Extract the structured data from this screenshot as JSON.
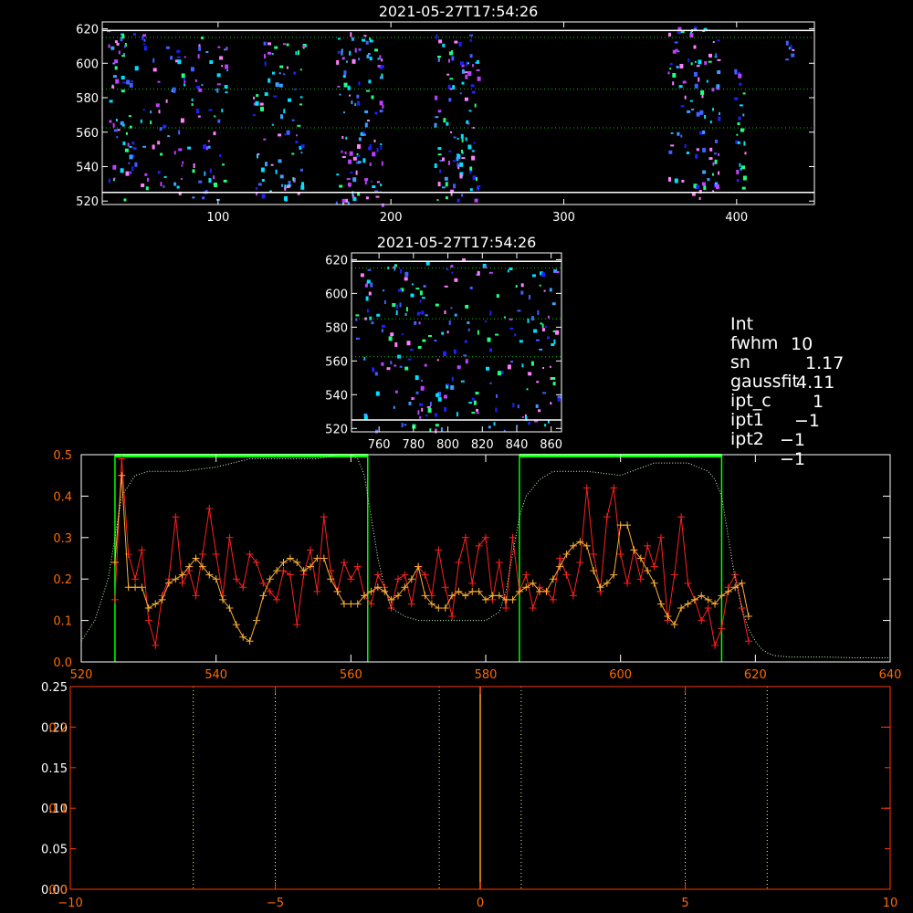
{
  "chart_data": [
    {
      "id": "top-image",
      "type": "heatmap",
      "title": "2021-05-27T17:54:26",
      "xlim": [
        33,
        445
      ],
      "ylim": [
        518,
        624
      ],
      "x_ticks": [
        100,
        200,
        300,
        400
      ],
      "y_ticks": [
        520,
        540,
        560,
        580,
        600,
        620
      ],
      "hlines_white": [
        525,
        619
      ],
      "hlines_green_dotted": [
        562.5,
        585,
        615
      ],
      "colors": {
        "background": "#000000",
        "axis": "#ffffff",
        "guide": "#00c800"
      },
      "pixel_palette": [
        "#2020ff",
        "#4060ff",
        "#3aa0ff",
        "#00e0ff",
        "#20ff80",
        "#c040ff",
        "#ff80ff"
      ],
      "pixel_clusters": [
        {
          "x_range": [
            35,
            52
          ],
          "y_range": [
            520,
            620
          ],
          "count": 60
        },
        {
          "x_range": [
            55,
            105
          ],
          "y_range": [
            520,
            620
          ],
          "count": 110
        },
        {
          "x_range": [
            120,
            150
          ],
          "y_range": [
            522,
            615
          ],
          "count": 80
        },
        {
          "x_range": [
            168,
            195
          ],
          "y_range": [
            518,
            620
          ],
          "count": 110
        },
        {
          "x_range": [
            225,
            250
          ],
          "y_range": [
            520,
            618
          ],
          "count": 100
        },
        {
          "x_range": [
            360,
            390
          ],
          "y_range": [
            522,
            622
          ],
          "count": 100
        },
        {
          "x_range": [
            398,
            405
          ],
          "y_range": [
            528,
            598
          ],
          "count": 25
        },
        {
          "x_range": [
            428,
            432
          ],
          "y_range": [
            598,
            620
          ],
          "count": 6
        }
      ]
    },
    {
      "id": "middle-image",
      "type": "heatmap",
      "title": "2021-05-27T17:54:26",
      "xlim": [
        744,
        866
      ],
      "ylim": [
        518,
        624
      ],
      "x_ticks": [
        760,
        780,
        800,
        820,
        840,
        860
      ],
      "y_ticks": [
        520,
        540,
        560,
        580,
        600,
        620
      ],
      "hlines_white": [
        525,
        619
      ],
      "hlines_green_dotted": [
        562.5,
        585,
        615
      ],
      "colors": {
        "background": "#000000",
        "axis": "#ffffff",
        "guide": "#00c800"
      },
      "pixel_palette": [
        "#2020ff",
        "#4060ff",
        "#3aa0ff",
        "#00e0ff",
        "#20ff80",
        "#c040ff",
        "#ff80ff"
      ],
      "pixel_clusters": [
        {
          "x_range": [
            746,
            864
          ],
          "y_range": [
            519,
            621
          ],
          "count": 230
        }
      ]
    },
    {
      "id": "profile-plot",
      "type": "line",
      "xlim": [
        520,
        640
      ],
      "ylim": [
        0,
        0.5
      ],
      "x_ticks": [
        520,
        540,
        560,
        580,
        600,
        620,
        640
      ],
      "y_ticks": [
        0.0,
        0.1,
        0.2,
        0.3,
        0.4,
        0.5
      ],
      "y_tick_labels": [
        "0.0",
        "0.1",
        "0.2",
        "0.3",
        "0.4",
        "0.5"
      ],
      "colors": {
        "axis": "#ffffff",
        "tick_labels": "#ff6a00",
        "window": "#00ff00",
        "window_bar": "#00ff00",
        "reference": "#c8ffc8"
      },
      "windows": [
        [
          525,
          562.5
        ],
        [
          585,
          615
        ]
      ],
      "series": [
        {
          "color": "#ff2020",
          "style": "line+plus",
          "x": [
            525,
            526,
            527,
            528,
            529,
            530,
            531,
            532,
            533,
            534,
            535,
            536,
            537,
            538,
            539,
            540,
            541,
            542,
            543,
            544,
            545,
            546,
            547,
            548,
            549,
            550,
            551,
            552,
            553,
            554,
            555,
            556,
            557,
            558,
            559,
            560,
            561,
            562,
            563,
            564,
            565,
            566,
            567,
            568,
            569,
            570,
            571,
            572,
            573,
            574,
            575,
            576,
            577,
            578,
            579,
            580,
            581,
            582,
            583,
            584,
            585,
            586,
            587,
            588,
            589,
            590,
            591,
            592,
            593,
            594,
            595,
            596,
            597,
            598,
            599,
            600,
            601,
            602,
            603,
            604,
            605,
            606,
            607,
            608,
            609,
            610,
            611,
            612,
            613,
            614,
            615,
            616,
            617,
            618,
            619
          ],
          "y": [
            0.15,
            0.49,
            0.26,
            0.2,
            0.27,
            0.1,
            0.04,
            0.16,
            0.2,
            0.35,
            0.19,
            0.22,
            0.16,
            0.26,
            0.37,
            0.26,
            0.16,
            0.3,
            0.2,
            0.18,
            0.26,
            0.24,
            0.19,
            0.17,
            0.15,
            0.22,
            0.21,
            0.09,
            0.21,
            0.27,
            0.17,
            0.35,
            0.22,
            0.17,
            0.24,
            0.2,
            0.23,
            0.16,
            0.14,
            0.21,
            0.18,
            0.13,
            0.2,
            0.21,
            0.14,
            0.23,
            0.21,
            0.16,
            0.27,
            0.18,
            0.11,
            0.24,
            0.3,
            0.19,
            0.28,
            0.3,
            0.15,
            0.24,
            0.13,
            0.3,
            0.17,
            0.21,
            0.13,
            0.18,
            0.17,
            0.15,
            0.25,
            0.21,
            0.16,
            0.24,
            0.42,
            0.26,
            0.17,
            0.35,
            0.42,
            0.26,
            0.19,
            0.27,
            0.2,
            0.28,
            0.23,
            0.3,
            0.1,
            0.21,
            0.35,
            0.19,
            0.15,
            0.1,
            0.13,
            0.04,
            0.08,
            0.18,
            0.21,
            0.13,
            0.05
          ]
        },
        {
          "color": "#ffb030",
          "style": "line+plus",
          "x": [
            525,
            526,
            527,
            528,
            529,
            530,
            531,
            532,
            533,
            534,
            535,
            536,
            537,
            538,
            539,
            540,
            541,
            542,
            543,
            544,
            545,
            546,
            547,
            548,
            549,
            550,
            551,
            552,
            553,
            554,
            555,
            556,
            557,
            558,
            559,
            560,
            561,
            562,
            563,
            564,
            565,
            566,
            567,
            568,
            569,
            570,
            571,
            572,
            573,
            574,
            575,
            576,
            577,
            578,
            579,
            580,
            581,
            582,
            583,
            584,
            585,
            586,
            587,
            588,
            589,
            590,
            591,
            592,
            593,
            594,
            595,
            596,
            597,
            598,
            599,
            600,
            601,
            602,
            603,
            604,
            605,
            606,
            607,
            608,
            609,
            610,
            611,
            612,
            613,
            614,
            615,
            616,
            617,
            618,
            619
          ],
          "y": [
            0.24,
            0.45,
            0.18,
            0.18,
            0.18,
            0.13,
            0.14,
            0.15,
            0.19,
            0.2,
            0.21,
            0.23,
            0.25,
            0.23,
            0.21,
            0.2,
            0.15,
            0.13,
            0.09,
            0.06,
            0.05,
            0.1,
            0.16,
            0.2,
            0.22,
            0.24,
            0.25,
            0.24,
            0.22,
            0.23,
            0.25,
            0.25,
            0.2,
            0.17,
            0.14,
            0.14,
            0.14,
            0.16,
            0.17,
            0.18,
            0.17,
            0.15,
            0.16,
            0.18,
            0.2,
            0.23,
            0.16,
            0.14,
            0.13,
            0.13,
            0.16,
            0.17,
            0.16,
            0.17,
            0.17,
            0.15,
            0.16,
            0.16,
            0.15,
            0.15,
            0.17,
            0.18,
            0.19,
            0.17,
            0.17,
            0.2,
            0.23,
            0.26,
            0.28,
            0.29,
            0.28,
            0.22,
            0.18,
            0.19,
            0.21,
            0.33,
            0.33,
            0.27,
            0.25,
            0.22,
            0.19,
            0.14,
            0.11,
            0.09,
            0.13,
            0.14,
            0.15,
            0.16,
            0.15,
            0.14,
            0.16,
            0.17,
            0.18,
            0.19,
            0.11
          ]
        },
        {
          "color": "#c8ffc8",
          "style": "dotted",
          "x": [
            520,
            522,
            524,
            525,
            526,
            528,
            530,
            532,
            535,
            540,
            545,
            550,
            555,
            558,
            560,
            561,
            562,
            563,
            564,
            565,
            566,
            568,
            570,
            575,
            580,
            582,
            583,
            584,
            585,
            586,
            588,
            590,
            595,
            600,
            605,
            610,
            613,
            614,
            615,
            616,
            617,
            618,
            619,
            620,
            621,
            622,
            623,
            625,
            630,
            635,
            640
          ],
          "y": [
            0.05,
            0.1,
            0.2,
            0.3,
            0.4,
            0.45,
            0.46,
            0.46,
            0.46,
            0.47,
            0.49,
            0.49,
            0.49,
            0.5,
            0.5,
            0.49,
            0.45,
            0.35,
            0.25,
            0.18,
            0.13,
            0.11,
            0.1,
            0.1,
            0.1,
            0.12,
            0.17,
            0.26,
            0.35,
            0.4,
            0.44,
            0.46,
            0.46,
            0.45,
            0.48,
            0.48,
            0.46,
            0.44,
            0.4,
            0.3,
            0.2,
            0.13,
            0.08,
            0.05,
            0.03,
            0.02,
            0.015,
            0.012,
            0.012,
            0.01,
            0.01
          ]
        }
      ]
    },
    {
      "id": "bottom-plot",
      "type": "line",
      "xlim": [
        -10,
        10
      ],
      "ylim": [
        0,
        0.25
      ],
      "x_ticks": [
        -10,
        -5,
        0,
        5,
        10
      ],
      "y_ticks_white": [
        0.0,
        0.05,
        0.1,
        0.15,
        0.2,
        0.25
      ],
      "y_tick_labels_white": [
        "0.00",
        "0.05",
        "0.10",
        "0.15",
        "0.20",
        "0.25"
      ],
      "y_ticks_red": [
        0.0,
        0.1,
        0.2
      ],
      "y_tick_labels_red": [
        "0.0",
        "0.1",
        "0.2"
      ],
      "colors": {
        "axis": "#ff3a00",
        "tick_labels": "#ff6a00",
        "white_labels": "#ffffff",
        "dotted": "#ffff80",
        "center_line": "#ffa020"
      },
      "dotted_vlines": [
        -7,
        -5,
        -1,
        1,
        5,
        7
      ],
      "center_line_x": 0
    }
  ],
  "info": {
    "rows": [
      {
        "key": "Int",
        "value": "10"
      },
      {
        "key": "fwhm",
        "value": "1.17"
      },
      {
        "key": "sn",
        "value": "4.11"
      },
      {
        "key": "gaussfit",
        "value": "1"
      },
      {
        "key": "ipt_c",
        "value": "−1"
      },
      {
        "key": "ipt1",
        "value": "−1"
      },
      {
        "key": "ipt2",
        "value": "−1"
      }
    ]
  }
}
